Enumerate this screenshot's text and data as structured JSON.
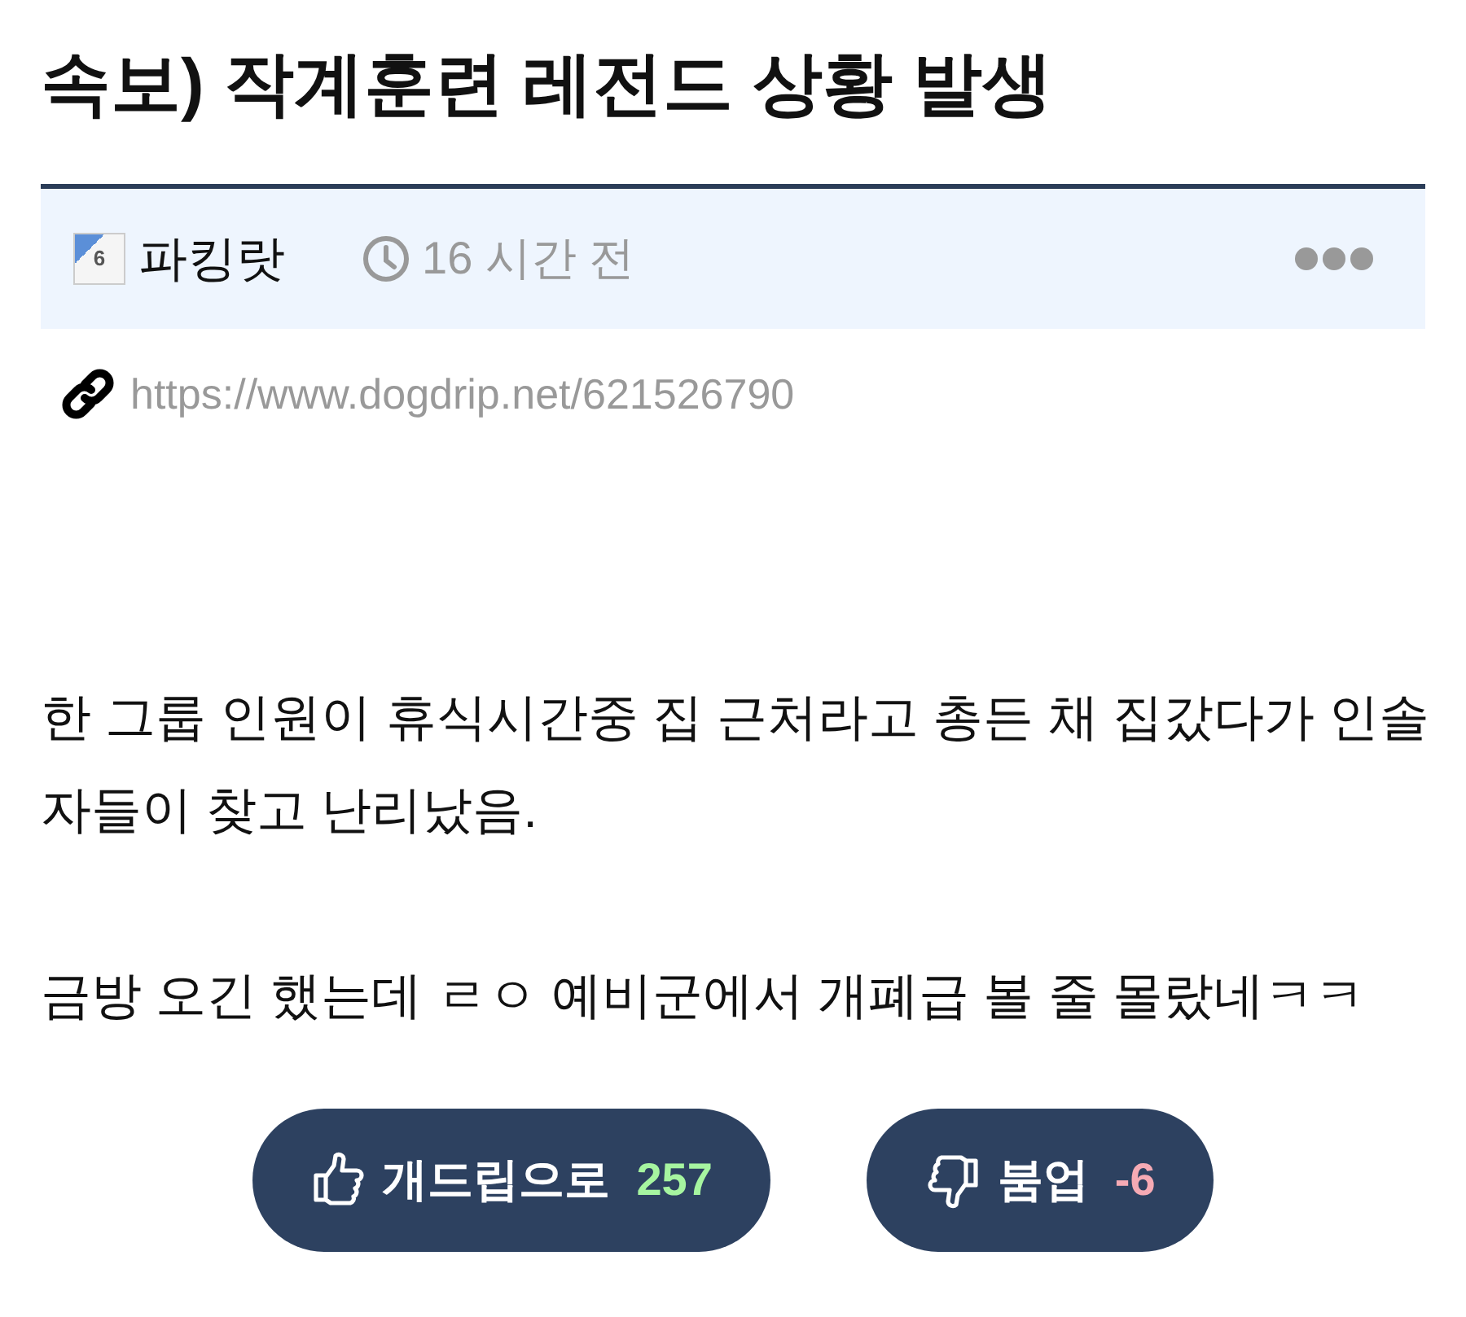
{
  "post": {
    "title": "속보) 작계훈련 레전드 상황 발생",
    "author": {
      "level": "6",
      "name": "파킹랏"
    },
    "time": "16 시간 전",
    "url": "https://www.dogdrip.net/621526790",
    "paragraphs": [
      "한 그룹 인원이 휴식시간중 집 근처라고 총든 채 집갔다가 인솔자들이 찾고 난리났음.",
      "금방 오긴 했는데 ㄹㅇ 예비군에서 개폐급 볼 줄 몰랐네ㅋㅋ"
    ]
  },
  "votes": [
    {
      "kind": "up",
      "label": "개드립으로",
      "count": "257"
    },
    {
      "kind": "down",
      "label": "붐업",
      "count": "-6"
    }
  ]
}
